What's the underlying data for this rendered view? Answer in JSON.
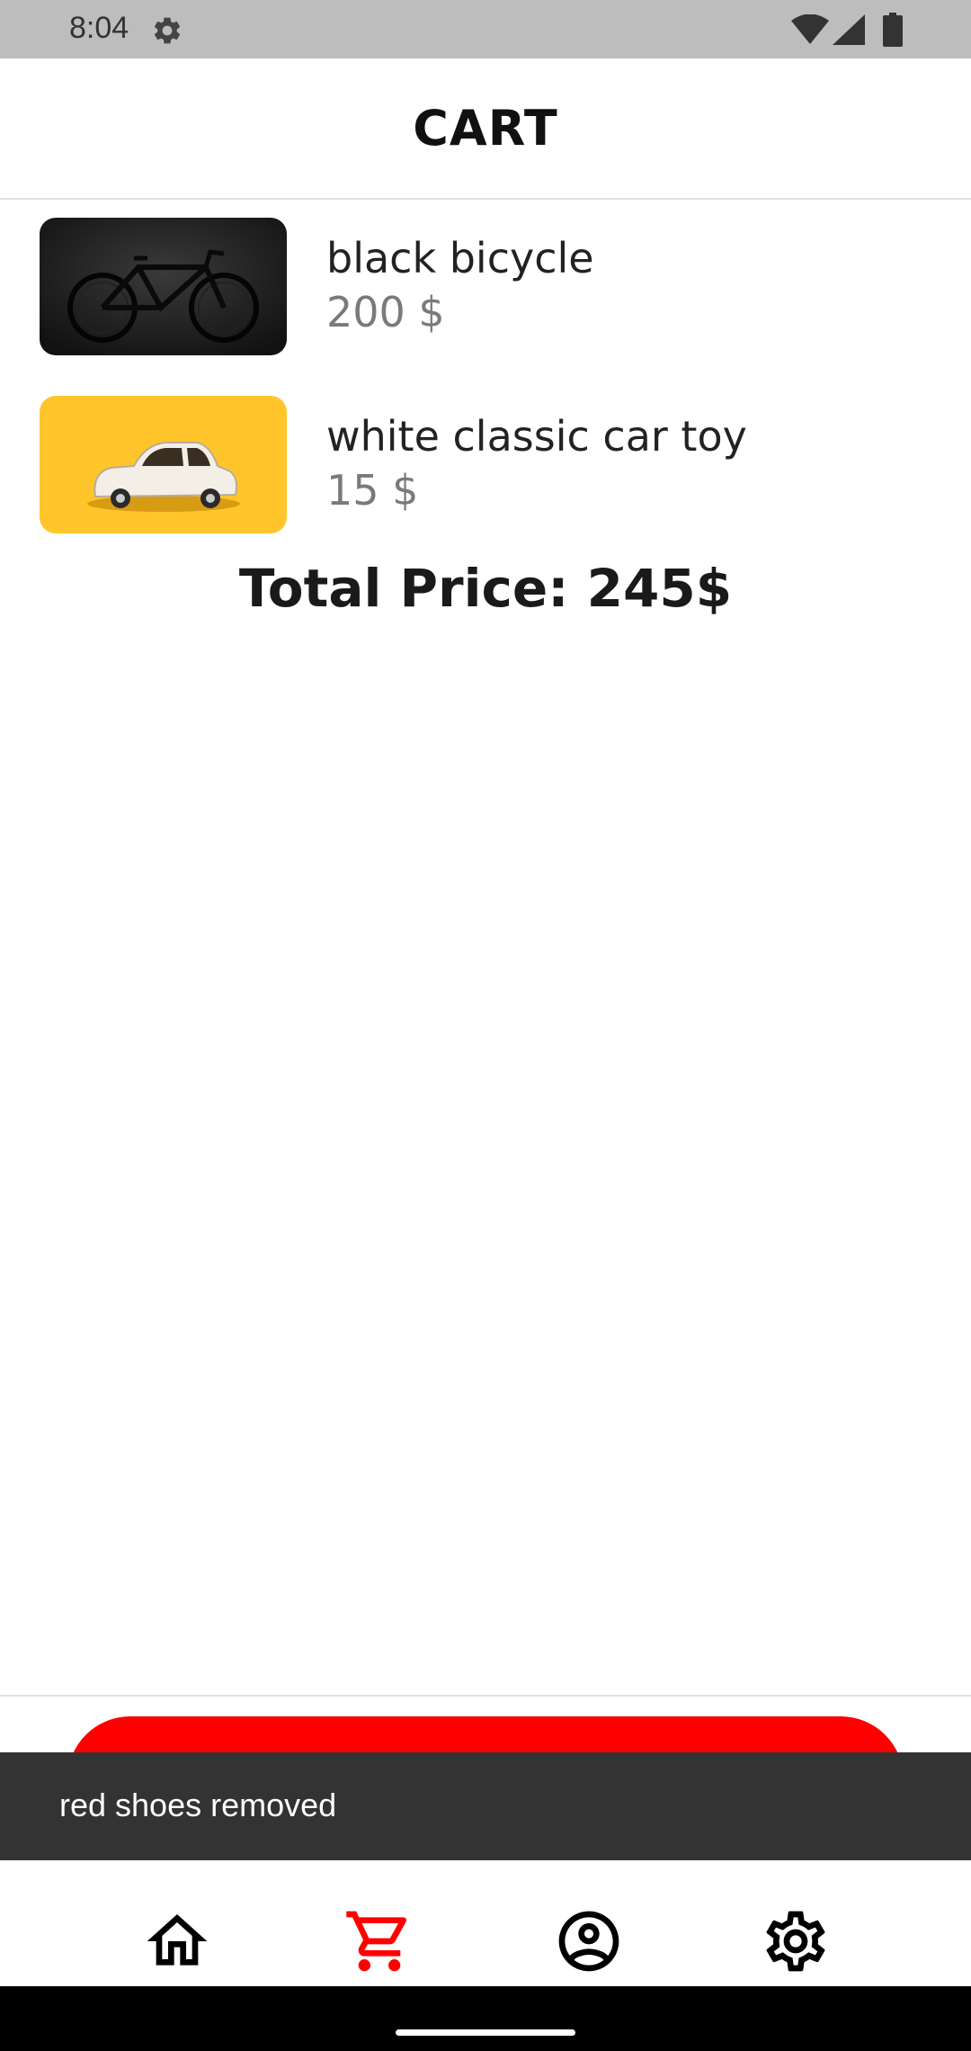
{
  "status_bar": {
    "time": "8:04",
    "icons": [
      "gear-icon",
      "wifi-icon",
      "signal-icon",
      "battery-icon"
    ]
  },
  "header": {
    "title": "CART"
  },
  "cart": {
    "items": [
      {
        "name": "black bicycle",
        "price": "200 $",
        "image": "bicycle-image"
      },
      {
        "name": "white classic car toy",
        "price": "15 $",
        "image": "car-toy-image"
      }
    ],
    "total_label": "Total Price: 245$"
  },
  "snackbar": {
    "message": "red shoes removed"
  },
  "bottom_nav": {
    "items": [
      {
        "icon": "home-icon",
        "active": false
      },
      {
        "icon": "cart-icon",
        "active": true
      },
      {
        "icon": "account-icon",
        "active": false
      },
      {
        "icon": "settings-icon",
        "active": false
      }
    ]
  },
  "colors": {
    "accent": "#ff0000",
    "snackbar_bg": "#333333",
    "status_bar_bg": "#bdbdbd",
    "price_text": "#7a7a7a"
  }
}
